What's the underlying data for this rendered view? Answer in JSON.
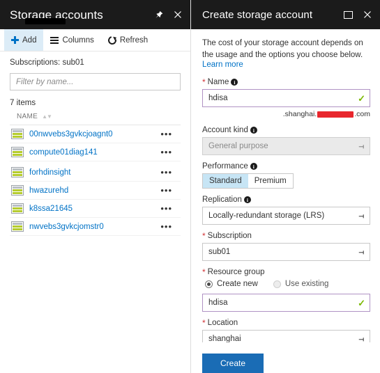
{
  "left_blade": {
    "title": "Storage accounts",
    "title_redacted": true,
    "window_icons": [
      {
        "name": "pin-icon",
        "glyph": "⚑"
      },
      {
        "name": "close-icon",
        "glyph": "✕"
      }
    ],
    "commands": [
      {
        "label": "Add",
        "icon": "plus-icon",
        "active": true
      },
      {
        "label": "Columns",
        "icon": "columns-icon",
        "active": false
      },
      {
        "label": "Refresh",
        "icon": "refresh-icon",
        "active": false
      }
    ],
    "subscriptions_label": "Subscriptions:",
    "subscriptions_value": "sub01",
    "filter_placeholder": "Filter by name...",
    "filter_value": "",
    "items_count": "7 items",
    "column_header": "NAME",
    "rows": [
      {
        "name": "00nwvebs3gvkcjoagnt0",
        "menu": "•••"
      },
      {
        "name": "compute01diag141",
        "menu": "•••"
      },
      {
        "name": "forhdinsight",
        "menu": "•••"
      },
      {
        "name": "hwazurehd",
        "menu": "•••"
      },
      {
        "name": "k8ssa21645",
        "menu": "•••"
      },
      {
        "name": "nwvebs3gvkcjomstr0",
        "menu": "•••"
      }
    ]
  },
  "right_blade": {
    "title": "Create storage account",
    "window_icons": [
      {
        "name": "restore-icon",
        "glyph": "□"
      },
      {
        "name": "close-icon",
        "glyph": "✕"
      }
    ],
    "blurb": "The cost of your storage account depends on the usage and the options you choose below.",
    "learn_more": "Learn more",
    "fields": {
      "name": {
        "label": "Name",
        "required": true,
        "value": "hdisa",
        "valid": true,
        "valid_glyph": "✓",
        "suffix_prefix": ".shanghai.",
        "suffix_redacted": true,
        "suffix_end": ".com"
      },
      "account_kind": {
        "label": "Account kind",
        "required": false,
        "value": "General purpose",
        "disabled": true
      },
      "performance": {
        "label": "Performance",
        "required": false,
        "options": [
          "Standard",
          "Premium"
        ],
        "selected": "Standard"
      },
      "replication": {
        "label": "Replication",
        "required": false,
        "value": "Locally-redundant storage (LRS)"
      },
      "subscription": {
        "label": "Subscription",
        "required": true,
        "value": "sub01"
      },
      "resource_group": {
        "label": "Resource group",
        "required": true,
        "options": [
          "Create new",
          "Use existing"
        ],
        "selected": "Create new",
        "value": "hdisa",
        "valid": true,
        "valid_glyph": "✓"
      },
      "location": {
        "label": "Location",
        "required": true,
        "value": "shanghai"
      }
    },
    "create_button": "Create",
    "accent_color": "#1a6cb5",
    "link_color": "#0072c6",
    "required_color": "#d13438",
    "valid_color": "#7ab800"
  }
}
